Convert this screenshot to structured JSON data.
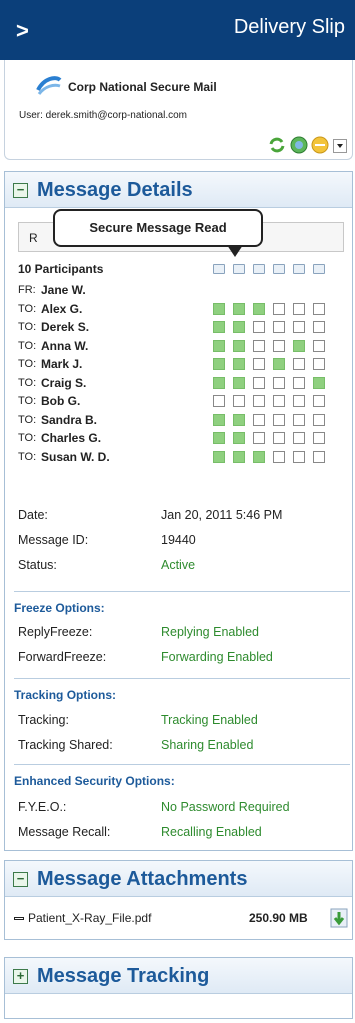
{
  "topbar": {
    "chevron": ">",
    "title": "Delivery Slip"
  },
  "plugin": {
    "name": "Corp National Secure Mail",
    "user_label": "User: derek.smith@corp-national.com"
  },
  "details_panel": {
    "title": "Message Details",
    "toggle": "−",
    "subject_prefix": "R",
    "tooltip": "Secure Message Read",
    "participants_label": "10 Participants",
    "column_icons": [
      "envelope-icon",
      "envelope-open-icon",
      "reply-icon",
      "forward-icon",
      "print-icon",
      "lock-icon"
    ],
    "participants": [
      {
        "role": "FR:",
        "name": "Jane W.",
        "status": null
      },
      {
        "role": "TO:",
        "name": "Alex G.",
        "status": [
          1,
          1,
          1,
          0,
          0,
          0
        ]
      },
      {
        "role": "TO:",
        "name": "Derek S.",
        "status": [
          1,
          1,
          0,
          0,
          0,
          0
        ]
      },
      {
        "role": "TO:",
        "name": "Anna W.",
        "status": [
          1,
          1,
          0,
          0,
          1,
          0
        ]
      },
      {
        "role": "TO:",
        "name": "Mark J.",
        "status": [
          1,
          1,
          0,
          1,
          0,
          0
        ]
      },
      {
        "role": "TO:",
        "name": "Craig S.",
        "status": [
          1,
          1,
          0,
          0,
          0,
          1
        ]
      },
      {
        "role": "TO:",
        "name": "Bob G.",
        "status": [
          0,
          0,
          0,
          0,
          0,
          0
        ]
      },
      {
        "role": "TO:",
        "name": "Sandra B.",
        "status": [
          1,
          1,
          0,
          0,
          0,
          0
        ]
      },
      {
        "role": "TO:",
        "name": "Charles G.",
        "status": [
          1,
          1,
          0,
          0,
          0,
          0
        ]
      },
      {
        "role": "TO:",
        "name": "Susan W. D.",
        "status": [
          1,
          1,
          1,
          0,
          0,
          0
        ]
      }
    ],
    "info": [
      {
        "key": "Date:",
        "value": "Jan 20, 2011 5:46 PM"
      },
      {
        "key": "Message ID:",
        "value": "19440"
      },
      {
        "key": "Status:",
        "value": "Active"
      }
    ],
    "freeze": {
      "title": "Freeze Options:",
      "rows": [
        {
          "key": "ReplyFreeze:",
          "value": "Replying Enabled"
        },
        {
          "key": "ForwardFreeze:",
          "value": "Forwarding Enabled"
        }
      ]
    },
    "tracking": {
      "title": "Tracking Options:",
      "rows": [
        {
          "key": "Tracking:",
          "value": "Tracking Enabled"
        },
        {
          "key": "Tracking Shared:",
          "value": "Sharing Enabled"
        }
      ]
    },
    "security": {
      "title": "Enhanced Security Options:",
      "rows": [
        {
          "key": "F.Y.E.O.:",
          "value": "No Password Required"
        },
        {
          "key": "Message Recall:",
          "value": "Recalling Enabled"
        }
      ]
    }
  },
  "attachments_panel": {
    "title": "Message Attachments",
    "toggle": "−",
    "file_name": "Patient_X-Ray_File.pdf",
    "file_size": "250.90 MB"
  },
  "tracking_panel": {
    "title": "Message Tracking",
    "toggle": "+"
  },
  "colors": {
    "topbar": "#0b3f7a",
    "accent": "#1d5a9a",
    "status_green": "#2e8b2e",
    "cell_on": "#8fd07f"
  }
}
